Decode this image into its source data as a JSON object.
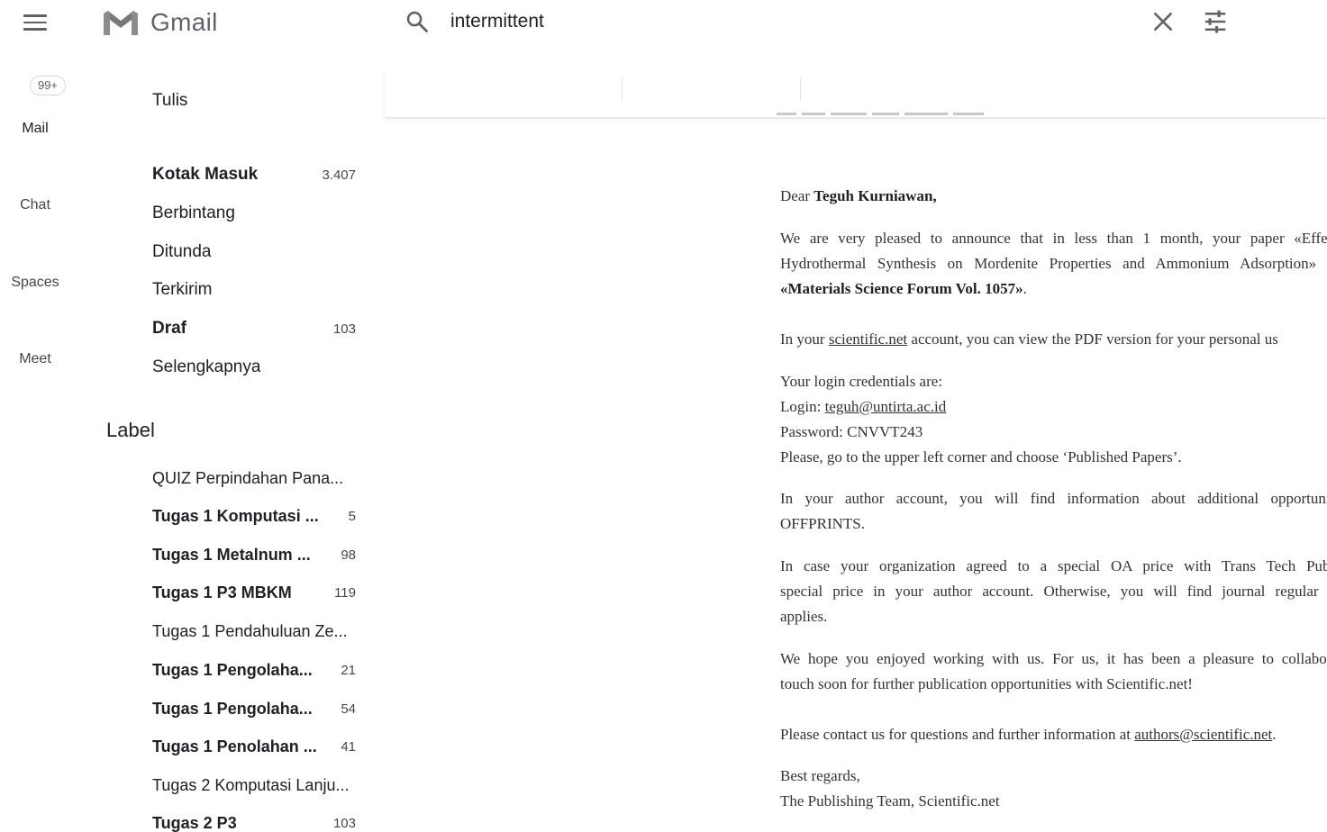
{
  "app": {
    "logo_text": "Gmail"
  },
  "search": {
    "value": "intermittent"
  },
  "rail": {
    "badge": "99+",
    "items": [
      {
        "label": "Mail"
      },
      {
        "label": "Chat"
      },
      {
        "label": "Spaces"
      },
      {
        "label": "Meet"
      }
    ]
  },
  "nav": {
    "compose_label": "Tulis",
    "folders": [
      {
        "name": "Kotak Masuk",
        "count": "3.407"
      },
      {
        "name": "Berbintang",
        "count": ""
      },
      {
        "name": "Ditunda",
        "count": ""
      },
      {
        "name": "Terkirim",
        "count": ""
      },
      {
        "name": "Draf",
        "count": "103"
      },
      {
        "name": "Selengkapnya",
        "count": ""
      }
    ],
    "label_heading": "Label",
    "labels": [
      {
        "name": "QUIZ Perpindahan Pana...",
        "count": ""
      },
      {
        "name": "Tugas 1 Komputasi ...",
        "count": "5"
      },
      {
        "name": "Tugas 1 Metalnum ...",
        "count": "98"
      },
      {
        "name": "Tugas 1 P3 MBKM",
        "count": "119"
      },
      {
        "name": "Tugas 1 Pendahuluan Ze...",
        "count": ""
      },
      {
        "name": "Tugas 1 Pengolaha...",
        "count": "21"
      },
      {
        "name": "Tugas 1 Pengolaha...",
        "count": "54"
      },
      {
        "name": "Tugas 1 Penolahan ...",
        "count": "41"
      },
      {
        "name": "Tugas 2 Komputasi Lanju...",
        "count": ""
      },
      {
        "name": "Tugas 2 P3",
        "count": "103"
      }
    ]
  },
  "email": {
    "greeting_prefix": "Dear ",
    "recipient_name": "Teguh Kurniawan,",
    "p1_line1": "We are very pleased to announce that in less than 1 month, your paper «Effect",
    "p1_line2": "Hydrothermal Synthesis on Mordenite Properties and Ammonium Adsorption» w",
    "p1_line3_bold": "«Materials Science Forum Vol. 1057»",
    "p1_line3_end": ".",
    "p2_prefix": "In your ",
    "p2_link": "scientific.net",
    "p2_suffix": " account, you can view the PDF version for your personal us",
    "cred_heading": "Your login credentials are:",
    "login_prefix": "Login: ",
    "login_email": "teguh@untirta.ac.id",
    "password_line": "Password: CNVVT243",
    "instruction": "Please, go to the upper left corner and choose ‘Published Papers’.",
    "p3_line1": "In your author account, you will find information about additional opportuniti",
    "p3_line2": "OFFPRINTS.",
    "p4_line1": "In case your organization agreed to a special OA price with Trans Tech Publi",
    "p4_line2": "special price in your author account. Otherwise, you will find journal regular A",
    "p4_line3": "applies.",
    "p5_line1": "We hope you enjoyed working with us. For us, it has been a pleasure to collabora",
    "p5_line2": "touch soon for further publication opportunities with Scientific.net!",
    "contact_prefix": "Please contact us for questions and further information at ",
    "contact_link": "authors@scientific.net",
    "contact_suffix": ".",
    "signoff": "Best regards,",
    "signature": "The Publishing Team, Scientific.net"
  }
}
